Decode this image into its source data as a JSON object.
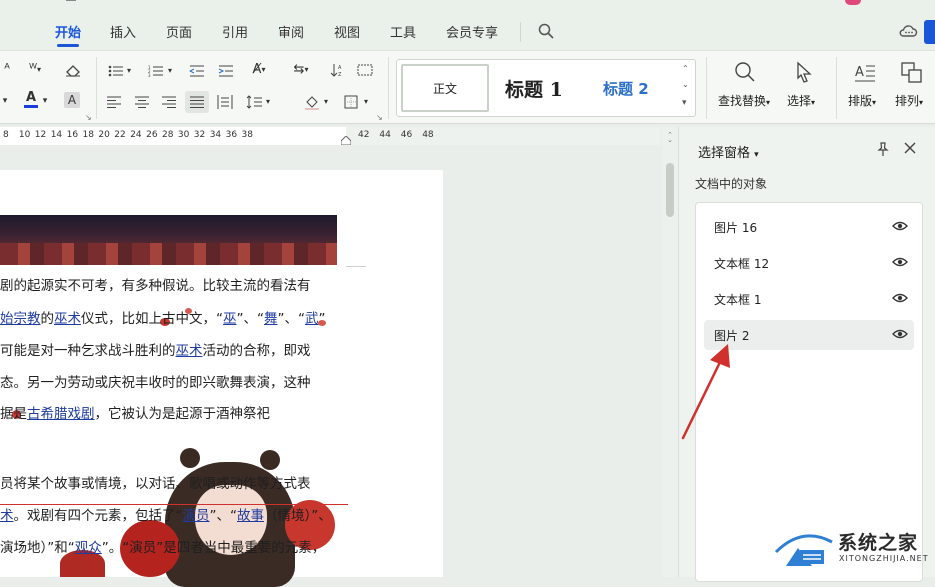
{
  "menu": {
    "tabs": [
      "开始",
      "插入",
      "页面",
      "引用",
      "审阅",
      "视图",
      "工具",
      "会员专享"
    ],
    "active_tab": "开始"
  },
  "ribbon": {
    "styles": {
      "normal": "正文",
      "heading1": "标题 1",
      "heading2": "标题 2"
    },
    "find_replace": "查找替换",
    "select": "选择",
    "arrange": "排版",
    "sort": "排列"
  },
  "ruler": {
    "ticks": [
      "8",
      "10",
      "12",
      "14",
      "16",
      "18",
      "20",
      "22",
      "24",
      "26",
      "28",
      "30",
      "32",
      "34",
      "36",
      "38",
      "42",
      "44",
      "46",
      "48"
    ]
  },
  "document": {
    "lines": [
      {
        "parts": [
          {
            "t": "剧的起源实不可考，有多种假说。比较主流的看法有",
            "l": false
          }
        ]
      },
      {
        "parts": [
          {
            "t": "始宗教",
            "l": true
          },
          {
            "t": "的",
            "l": false
          },
          {
            "t": "巫术",
            "l": true
          },
          {
            "t": "仪式，比如上古中文，“",
            "l": false
          },
          {
            "t": "巫",
            "l": true
          },
          {
            "t": "”、“",
            "l": false
          },
          {
            "t": "舞",
            "l": true
          },
          {
            "t": "”、“",
            "l": false
          },
          {
            "t": "武",
            "l": true
          },
          {
            "t": "”",
            "l": false
          }
        ]
      },
      {
        "parts": [
          {
            "t": "可能是对一种乞求战斗胜利的",
            "l": false
          },
          {
            "t": "巫术",
            "l": true
          },
          {
            "t": "活动的合称，即戏",
            "l": false
          }
        ]
      },
      {
        "parts": [
          {
            "t": "态。另一为劳动或庆祝丰收时的即兴歌舞表演，这种",
            "l": false
          }
        ]
      },
      {
        "parts": [
          {
            "t": "据是",
            "l": false
          },
          {
            "t": "古希腊戏剧",
            "l": true
          },
          {
            "t": "，它被认为是起源于酒神祭祀",
            "l": false
          }
        ]
      },
      {
        "parts": [
          {
            "t": "员将某个故事或情境，以对话、歌唱或动作等方式表",
            "l": false
          }
        ]
      },
      {
        "parts": [
          {
            "t": "术",
            "l": true
          },
          {
            "t": "。戏剧有四个元素，包括了“",
            "l": false
          },
          {
            "t": "演员",
            "l": true
          },
          {
            "t": "”、“",
            "l": false
          },
          {
            "t": "故事",
            "l": true
          },
          {
            "t": "（情境）”、",
            "l": false
          }
        ]
      },
      {
        "parts": [
          {
            "t": "演场地）”和“",
            "l": false
          },
          {
            "t": "观众",
            "l": true
          },
          {
            "t": "”。“演员”是四者当中最重要的元素，",
            "l": false
          }
        ]
      }
    ]
  },
  "selection_pane": {
    "title": "选择窗格",
    "subtitle": "文档中的对象",
    "objects": [
      {
        "label": "图片 16",
        "selected": false
      },
      {
        "label": "文本框 12",
        "selected": false
      },
      {
        "label": "文本框 1",
        "selected": false
      },
      {
        "label": "图片 2",
        "selected": true
      }
    ]
  },
  "watermark": {
    "name": "系统之家",
    "url": "XITONGZHIJIA.NET"
  },
  "colors": {
    "accent": "#1a56d8",
    "link": "#1f3c9e",
    "arrow": "#d0312d",
    "heading2": "#2a6fc9"
  }
}
